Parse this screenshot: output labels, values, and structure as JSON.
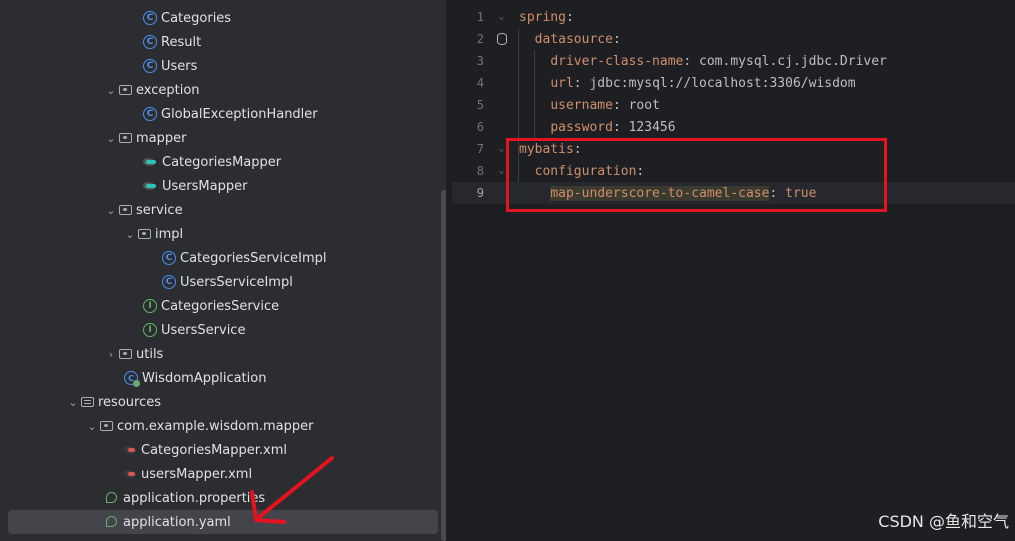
{
  "project_tree": {
    "items": [
      {
        "label": "Categories",
        "icon": "class-icon"
      },
      {
        "label": "Result",
        "icon": "class-icon"
      },
      {
        "label": "Users",
        "icon": "class-icon"
      },
      {
        "label": "exception",
        "icon": "folder-icon"
      },
      {
        "label": "GlobalExceptionHandler",
        "icon": "class-icon"
      },
      {
        "label": "mapper",
        "icon": "folder-icon"
      },
      {
        "label": "CategoriesMapper",
        "icon": "mybatis-mapper-icon"
      },
      {
        "label": "UsersMapper",
        "icon": "mybatis-mapper-icon"
      },
      {
        "label": "service",
        "icon": "folder-icon"
      },
      {
        "label": "impl",
        "icon": "folder-icon"
      },
      {
        "label": "CategoriesServiceImpl",
        "icon": "class-icon"
      },
      {
        "label": "UsersServiceImpl",
        "icon": "class-icon"
      },
      {
        "label": "CategoriesService",
        "icon": "interface-icon"
      },
      {
        "label": "UsersService",
        "icon": "interface-icon"
      },
      {
        "label": "utils",
        "icon": "folder-icon"
      },
      {
        "label": "WisdomApplication",
        "icon": "spring-boot-app-icon"
      },
      {
        "label": "resources",
        "icon": "resources-folder-icon"
      },
      {
        "label": "com.example.wisdom.mapper",
        "icon": "folder-icon"
      },
      {
        "label": "CategoriesMapper.xml",
        "icon": "mybatis-xml-icon"
      },
      {
        "label": "usersMapper.xml",
        "icon": "mybatis-xml-icon"
      },
      {
        "label": "application.properties",
        "icon": "spring-config-icon"
      },
      {
        "label": "application.yaml",
        "icon": "spring-config-icon",
        "selected": true
      }
    ]
  },
  "editor": {
    "lines": [
      {
        "num": "1",
        "key": "spring",
        "sep": ":",
        "value": ""
      },
      {
        "num": "2",
        "key": "datasource",
        "sep": ":",
        "value": ""
      },
      {
        "num": "3",
        "key": "driver-class-name",
        "sep": ":",
        "value": " com.mysql.cj.jdbc.Driver"
      },
      {
        "num": "4",
        "key": "url",
        "sep": ":",
        "value": " jdbc:mysql://localhost:3306/wisdom"
      },
      {
        "num": "5",
        "key": "username",
        "sep": ":",
        "value": " root"
      },
      {
        "num": "6",
        "key": "password",
        "sep": ":",
        "value": " 123456"
      },
      {
        "num": "7",
        "key": "mybatis",
        "sep": ":",
        "value": ""
      },
      {
        "num": "8",
        "key": "configuration",
        "sep": ":",
        "value": ""
      },
      {
        "num": "9",
        "key": "map-underscore-to-camel-case",
        "sep": ":",
        "value": " true"
      }
    ]
  },
  "watermark": "CSDN @鱼和空气",
  "colors": {
    "annotation_red": "#e5131f",
    "yaml_key": "#cf8e6d",
    "text": "#bcbec4"
  }
}
